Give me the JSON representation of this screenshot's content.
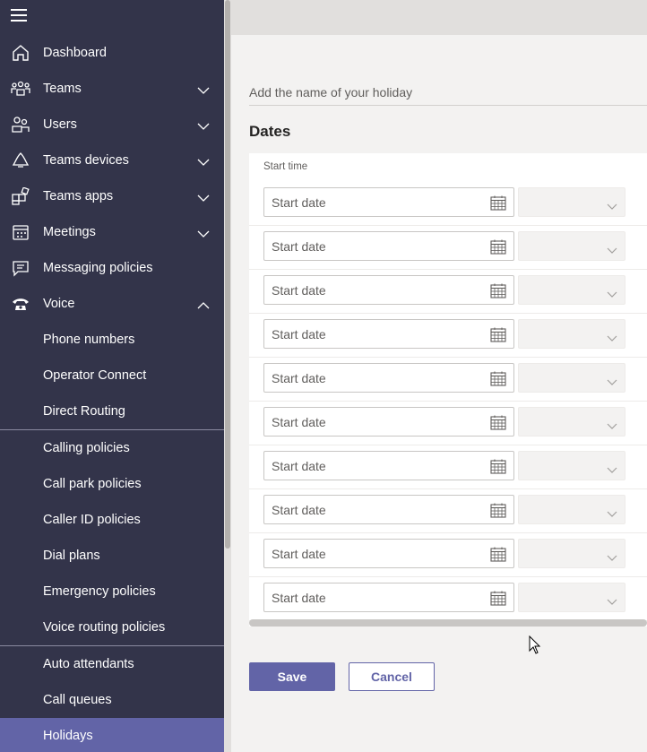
{
  "sidebar": {
    "items": [
      {
        "label": "Dashboard",
        "icon": "home-icon",
        "expandable": false
      },
      {
        "label": "Teams",
        "icon": "teams-icon",
        "expandable": true,
        "expanded": false
      },
      {
        "label": "Users",
        "icon": "users-icon",
        "expandable": true,
        "expanded": false
      },
      {
        "label": "Teams devices",
        "icon": "bell-device-icon",
        "expandable": true,
        "expanded": false
      },
      {
        "label": "Teams apps",
        "icon": "apps-icon",
        "expandable": true,
        "expanded": false
      },
      {
        "label": "Meetings",
        "icon": "calendar-icon",
        "expandable": true,
        "expanded": false
      },
      {
        "label": "Messaging policies",
        "icon": "message-icon",
        "expandable": false
      },
      {
        "label": "Voice",
        "icon": "phone-icon",
        "expandable": true,
        "expanded": true
      }
    ],
    "voice_group_1": [
      "Phone numbers",
      "Operator Connect",
      "Direct Routing"
    ],
    "voice_group_2": [
      "Calling policies",
      "Call park policies",
      "Caller ID policies",
      "Dial plans",
      "Emergency policies",
      "Voice routing policies"
    ],
    "voice_group_3": [
      "Auto attendants",
      "Call queues",
      "Holidays"
    ],
    "active_item": "Holidays"
  },
  "form": {
    "name_placeholder": "Add the name of your holiday",
    "dates_heading": "Dates",
    "start_time_header": "Start time",
    "date_placeholder": "Start date",
    "row_count": 10
  },
  "buttons": {
    "save": "Save",
    "cancel": "Cancel"
  },
  "colors": {
    "sidebar_bg": "#33344a",
    "accent": "#6264a7",
    "main_bg": "#f3f2f1"
  }
}
